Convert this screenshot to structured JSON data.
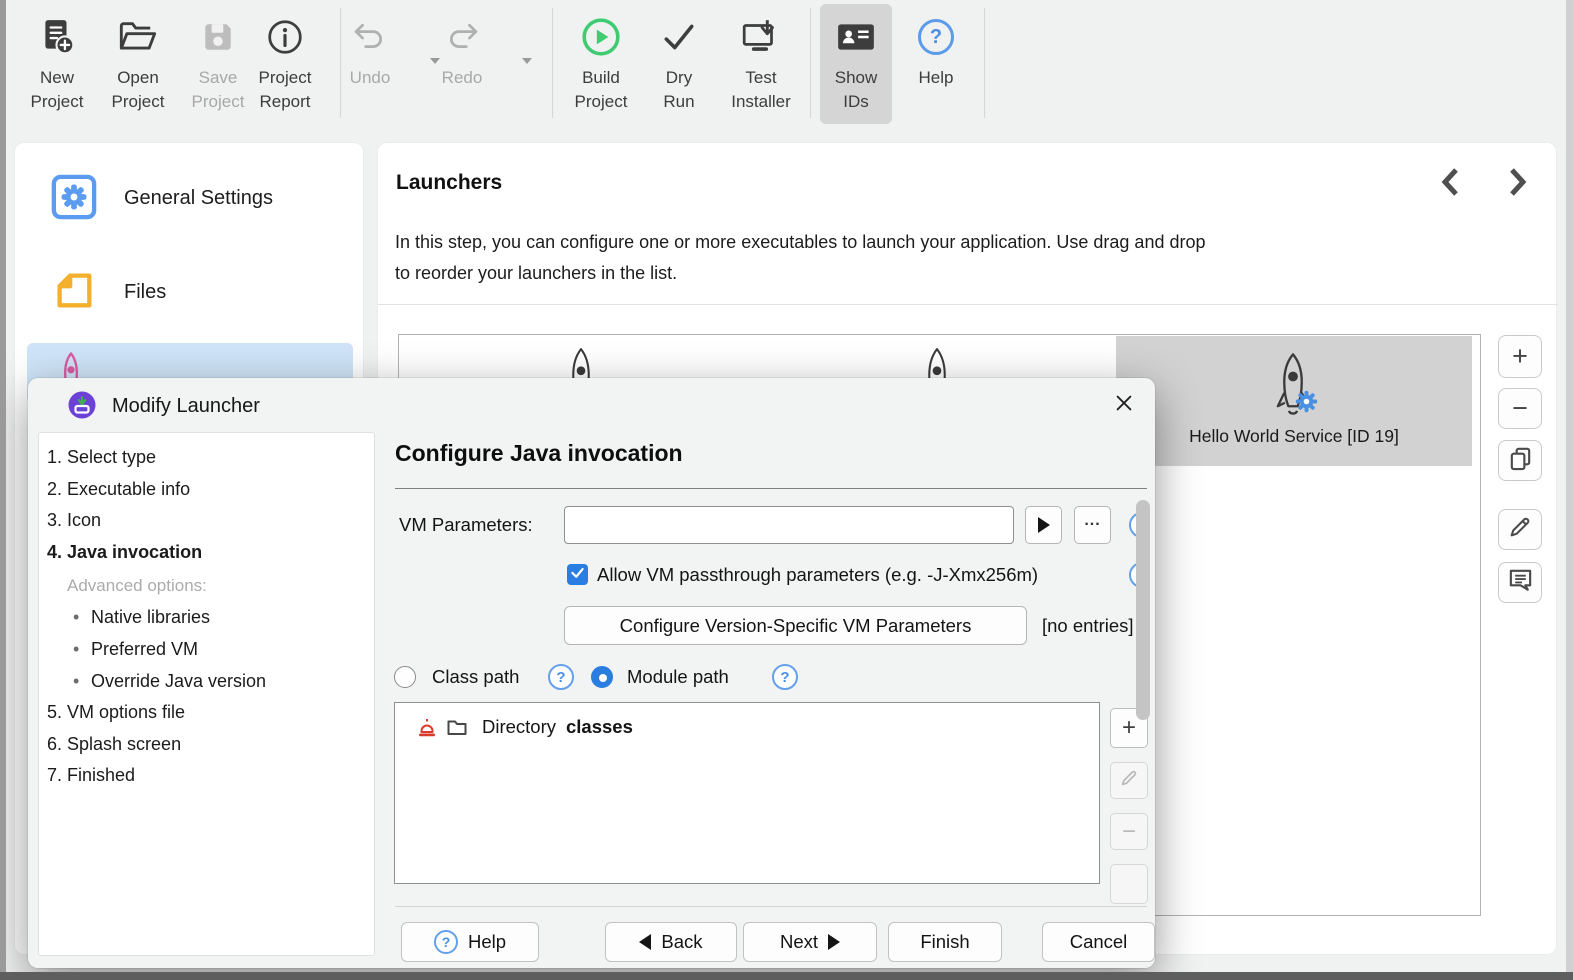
{
  "window": {
    "background": "#f0f1f1",
    "accent": "#2a7de1"
  },
  "toolbar": {
    "items": [
      {
        "label": "New\nProject",
        "enabled": true
      },
      {
        "label": "Open\nProject",
        "enabled": true
      },
      {
        "label": "Save\nProject",
        "enabled": false
      },
      {
        "label": "Project\nReport",
        "enabled": true
      },
      {
        "label": "Undo",
        "enabled": false,
        "has_dropdown": true
      },
      {
        "label": "Redo",
        "enabled": false,
        "has_dropdown": true
      },
      {
        "label": "Build\nProject",
        "enabled": true
      },
      {
        "label": "Dry\nRun",
        "enabled": true
      },
      {
        "label": "Test\nInstaller",
        "enabled": true
      },
      {
        "label": "Show\nIDs",
        "enabled": true,
        "active": true
      },
      {
        "label": "Help",
        "enabled": true
      }
    ]
  },
  "sidebar": {
    "items": [
      {
        "label": "General Settings",
        "selected": false
      },
      {
        "label": "Files",
        "selected": false
      },
      {
        "label": "",
        "selected": true
      }
    ]
  },
  "main": {
    "title": "Launchers",
    "description": "In this step, you can configure one or more executables to launch your application. Use drag and drop\nto reorder your launchers in the list.",
    "selected_launcher_label": "Hello World Service [ID 19]"
  },
  "dialog": {
    "title": "Modify Launcher",
    "steps": [
      {
        "label": "1. Select type",
        "current": false
      },
      {
        "label": "2. Executable info",
        "current": false
      },
      {
        "label": "3. Icon",
        "current": false
      },
      {
        "label": "4. Java invocation",
        "current": true
      }
    ],
    "advanced": {
      "header": "Advanced options:",
      "items": [
        "Native libraries",
        "Preferred VM",
        "Override Java version"
      ]
    },
    "steps_tail": [
      {
        "label": "5. VM options file"
      },
      {
        "label": "6. Splash screen"
      },
      {
        "label": "7. Finished"
      }
    ],
    "content": {
      "heading": "Configure Java invocation",
      "vm_parameters": {
        "label": "VM Parameters:",
        "value": ""
      },
      "passthrough": {
        "label": "Allow VM passthrough parameters (e.g. -J-Xmx256m)",
        "checked": true
      },
      "version_specific": {
        "button_label": "Configure Version-Specific VM Parameters",
        "status": "[no entries]"
      },
      "path_options": [
        {
          "label": "Class path",
          "selected": false
        },
        {
          "label": "Module path",
          "selected": true
        }
      ],
      "entries": [
        {
          "kind": "Directory",
          "name": "classes"
        }
      ]
    },
    "footer": {
      "help": "Help",
      "back": "Back",
      "next": "Next",
      "finish": "Finish",
      "cancel": "Cancel"
    }
  },
  "icons": {
    "plus": "+",
    "minus": "−",
    "question": "?",
    "ellipsis": "...",
    "bullet": "•"
  }
}
